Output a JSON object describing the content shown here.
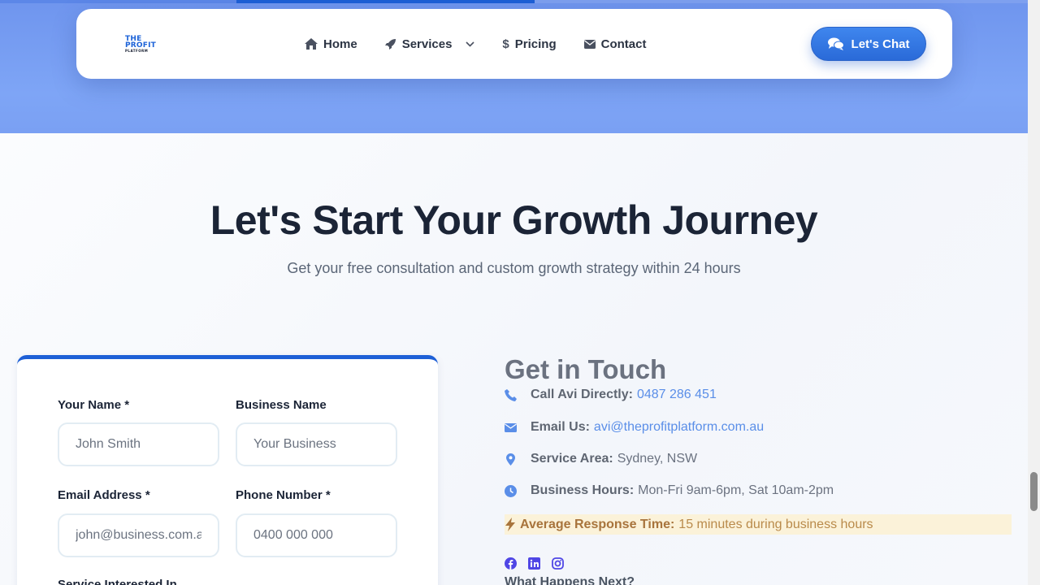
{
  "colors": {
    "brand": "#1d63d8",
    "accent": "#2a6ad8",
    "heading": "#1b2436",
    "highlight": "#fbf2d9"
  },
  "logo": {
    "line1": "THE",
    "line2": "PROFIT",
    "line3": "PLATFORM"
  },
  "nav": {
    "items": [
      {
        "label": "Home",
        "icon": "home-icon"
      },
      {
        "label": "Services",
        "icon": "rocket-icon"
      },
      {
        "label": "Pricing",
        "icon": "dollar-icon"
      },
      {
        "label": "Contact",
        "icon": "envelope-icon"
      }
    ],
    "cta": {
      "label": "Let's Chat",
      "icon": "chat-icon"
    }
  },
  "hero": {
    "title": "Let's Start Your Growth Journey",
    "subtitle": "Get your free consultation and custom growth strategy within 24 hours"
  },
  "form": {
    "name": {
      "label": "Your Name *",
      "placeholder": "John Smith"
    },
    "business": {
      "label": "Business Name",
      "placeholder": "Your Business"
    },
    "email": {
      "label": "Email Address *",
      "placeholder": "john@business.com.au"
    },
    "phone": {
      "label": "Phone Number *",
      "placeholder": "0400 000 000"
    },
    "service": {
      "label": "Service Interested In"
    }
  },
  "contact": {
    "title": "Get in Touch",
    "call": {
      "label": "Call Avi Directly:",
      "value": "0487 286 451",
      "icon": "phone-icon"
    },
    "email": {
      "label": "Email Us:",
      "value": "avi@theprofitplatform.com.au",
      "icon": "envelope-icon"
    },
    "area": {
      "label": "Service Area:",
      "value": "Sydney, NSW",
      "icon": "map-pin-icon"
    },
    "hours": {
      "label": "Business Hours:",
      "value": "Mon-Fri 9am-6pm, Sat 10am-2pm",
      "icon": "clock-icon"
    },
    "response": {
      "label": "Average Response Time:",
      "value": "15 minutes during business hours",
      "icon": "bolt-icon"
    },
    "socials": [
      "facebook-icon",
      "linkedin-icon",
      "instagram-icon"
    ],
    "next_title": "What Happens Next?"
  }
}
